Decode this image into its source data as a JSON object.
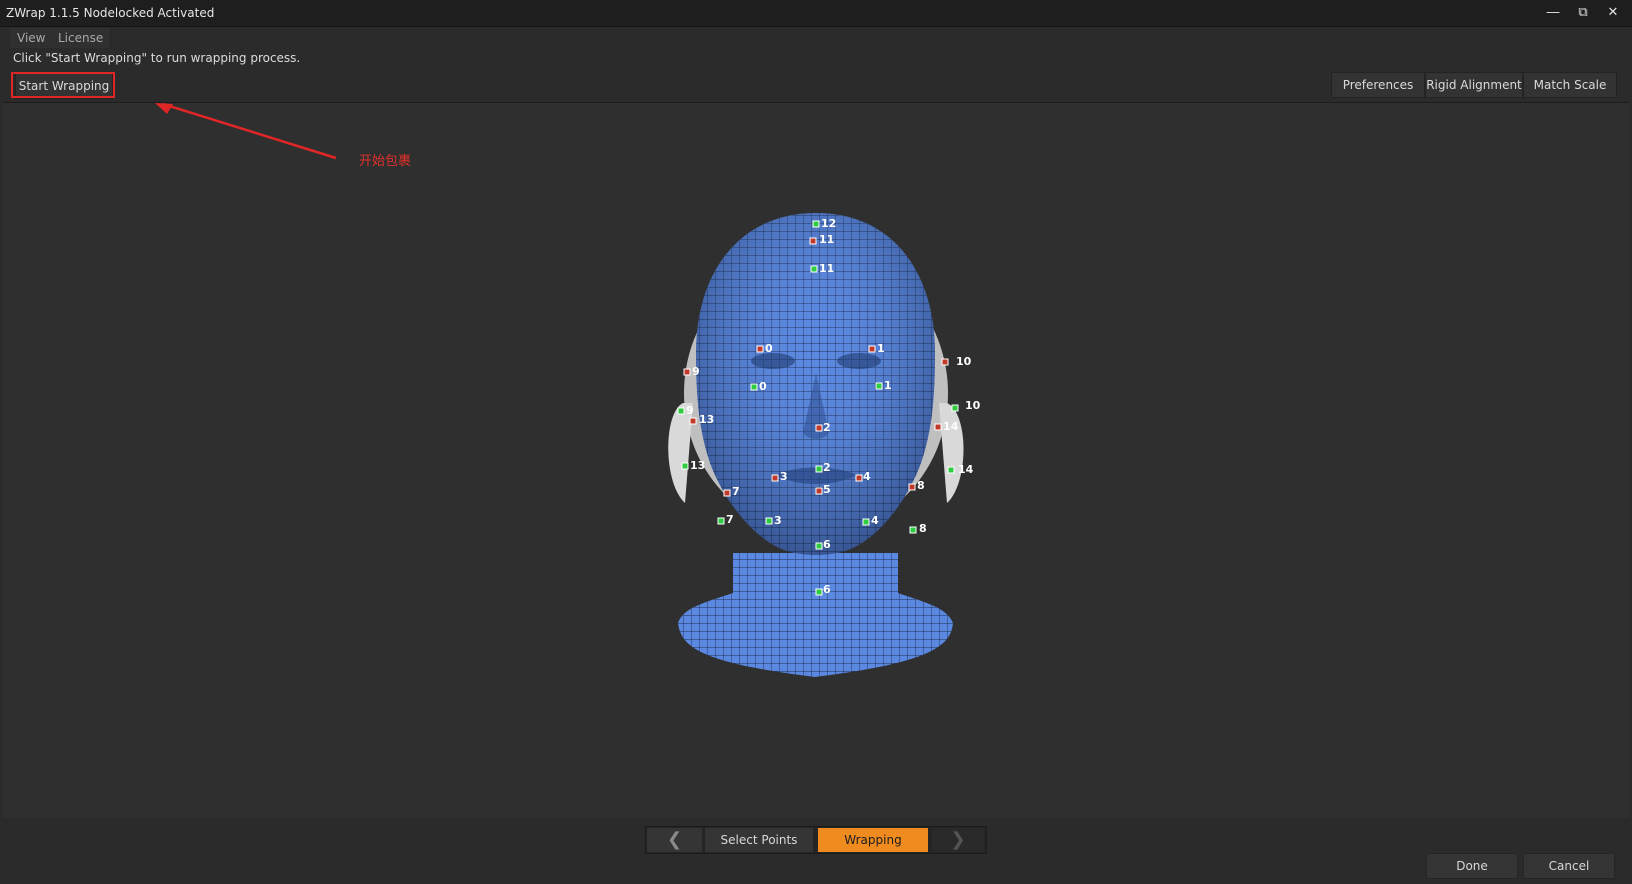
{
  "window": {
    "title": "ZWrap 1.1.5  Nodelocked Activated",
    "minimize_icon": "minimize-icon",
    "restore_icon": "restore-icon",
    "close_icon": "close-icon"
  },
  "menu": {
    "items": [
      "View",
      "License"
    ]
  },
  "hint": "Click \"Start Wrapping\" to run wrapping process.",
  "toolbar": {
    "start_wrapping": "Start Wrapping",
    "preferences": "Preferences",
    "rigid_alignment": "Rigid Alignment",
    "match_scale": "Match Scale"
  },
  "annotation": {
    "text": "开始包裹",
    "color": "#e02626"
  },
  "viewport": {
    "model": "head-mesh",
    "mesh_color": "#5b88e0",
    "ear_color": "#d8d8d8",
    "markers": {
      "source_color": "#c0392b",
      "target_color": "#2ecc40",
      "labels": [
        "12",
        "11",
        "11",
        "0",
        "1",
        "0",
        "1",
        "9",
        "10",
        "9",
        "10",
        "13",
        "14",
        "2",
        "2",
        "3",
        "4",
        "5",
        "7",
        "8",
        "13",
        "14",
        "7",
        "3",
        "4",
        "8",
        "6",
        "6"
      ]
    }
  },
  "steps": {
    "prev_icon": "chevron-left-icon",
    "select_points": "Select Points",
    "wrapping": "Wrapping",
    "next_icon": "chevron-right-icon",
    "active": "Wrapping",
    "active_color": "#f08c1f"
  },
  "footer": {
    "done": "Done",
    "cancel": "Cancel"
  }
}
